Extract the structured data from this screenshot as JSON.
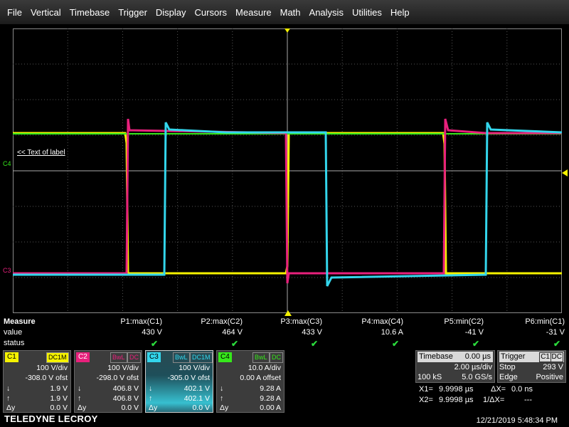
{
  "menu": [
    "File",
    "Vertical",
    "Timebase",
    "Trigger",
    "Display",
    "Cursors",
    "Measure",
    "Math",
    "Analysis",
    "Utilities",
    "Help"
  ],
  "grid": {
    "label_text": "<< Text of label",
    "c4_marker": "C4",
    "c3_marker": "C3",
    "colors": {
      "c1": "#f5f200",
      "c2": "#e8207c",
      "c3": "#33d6ec",
      "c4": "#36e81b"
    }
  },
  "measure": {
    "title": "Measure",
    "row_value": "value",
    "row_status": "status",
    "params": [
      {
        "name": "P1:max(C1)",
        "value": "430 V",
        "status": "✔"
      },
      {
        "name": "P2:max(C2)",
        "value": "464 V",
        "status": "✔"
      },
      {
        "name": "P3:max(C3)",
        "value": "433 V",
        "status": "✔"
      },
      {
        "name": "P4:max(C4)",
        "value": "10.6 A",
        "status": "✔"
      },
      {
        "name": "P5:min(C2)",
        "value": "-41 V",
        "status": "✔"
      },
      {
        "name": "P6:min(C1)",
        "value": "-31 V",
        "status": "✔"
      }
    ]
  },
  "channels": [
    {
      "name": "C1",
      "tags": [
        "DC1M"
      ],
      "color": "#f5f200",
      "scale": "100 V/div",
      "offset": "-308.0 V ofst",
      "min": "1.9 V",
      "max": "1.9 V",
      "delta": "0.0 V"
    },
    {
      "name": "C2",
      "tags": [
        "BwL",
        "DC"
      ],
      "color": "#e8207c",
      "scale": "100 V/div",
      "offset": "-298.0 V ofst",
      "min": "406.8 V",
      "max": "406.8 V",
      "delta": "0.0 V"
    },
    {
      "name": "C3",
      "tags": [
        "BwL",
        "DC1M"
      ],
      "color": "#33d6ec",
      "scale": "100 V/div",
      "offset": "-305.0 V ofst",
      "min": "402.1 V",
      "max": "402.1 V",
      "delta": "0.0 V"
    },
    {
      "name": "C4",
      "tags": [
        "BwL",
        "DC"
      ],
      "color": "#36e81b",
      "scale": "10.0 A/div",
      "offset": "0.00 A offset",
      "min": "9.28 A",
      "max": "9.28 A",
      "delta": "0.00 A"
    }
  ],
  "cursor_symbols": {
    "down": "↓",
    "up": "↑",
    "delta": "Δy"
  },
  "timebase": {
    "title": "Timebase",
    "delay": "0.00 µs",
    "per_div": "2.00 µs/div",
    "samples": "100 kS",
    "rate": "5.0 GS/s"
  },
  "trigger": {
    "title": "Trigger",
    "source": "C1",
    "coupling": "DC",
    "mode": "Stop",
    "level": "293 V",
    "type": "Edge",
    "slope": "Positive"
  },
  "cursors": {
    "x1_label": "X1=",
    "x1_value": "9.9998 µs",
    "dx_label": "ΔX=",
    "dx_value": "0.0 ns",
    "x2_label": "X2=",
    "x2_value": "9.9998 µs",
    "inv_dx_label": "1/ΔX=",
    "inv_dx_value": "---"
  },
  "brand": "TELEDYNE LECROY",
  "datetime": "12/21/2019 5:48:34 PM"
}
